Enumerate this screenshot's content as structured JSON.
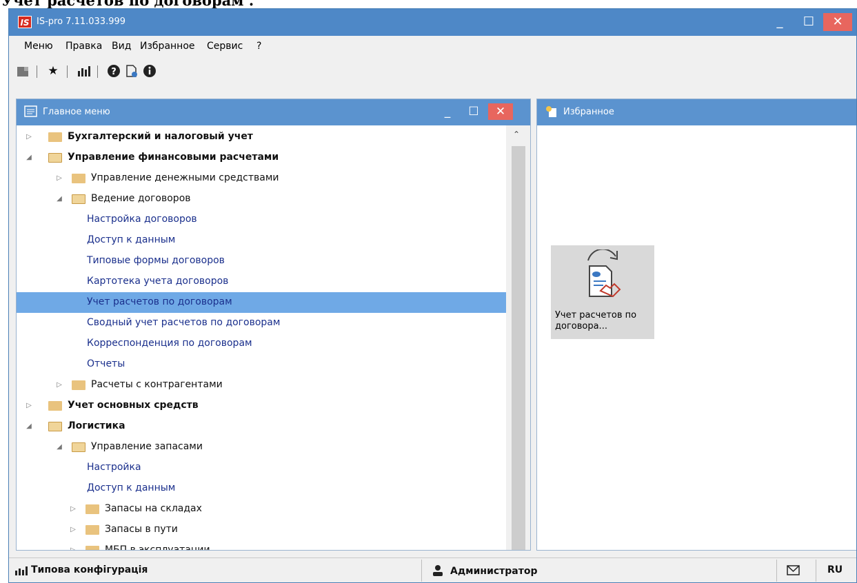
{
  "top_caption": "Учет расчетов по договорам .",
  "window": {
    "title": "IS-pro 7.11.033.999",
    "logo": "IS",
    "controls": {
      "minimize": "_",
      "maximize": "☐",
      "close": "✕"
    }
  },
  "menu": [
    "Меню",
    "Правка",
    "Вид",
    "Избранное",
    "Сервис",
    "?"
  ],
  "toolbar": {
    "icons": [
      "module-icon",
      "star-icon",
      "chart-icon",
      "help-icon",
      "document-info-icon",
      "info-icon"
    ]
  },
  "main_panel": {
    "title": "Главное меню",
    "controls": {
      "minimize": "_",
      "maximize": "☐",
      "close": "✕"
    },
    "tree": [
      {
        "label": "Бухгалтерский и налоговый учет",
        "level": 0,
        "kind": "folder",
        "expanded": false,
        "bold": true
      },
      {
        "label": "Управление финансовыми расчетами",
        "level": 0,
        "kind": "folder",
        "expanded": true,
        "bold": true
      },
      {
        "label": "Управление денежными средствами",
        "level": 1,
        "kind": "folder",
        "expanded": false,
        "bold": false
      },
      {
        "label": "Ведение договоров",
        "level": 1,
        "kind": "folder",
        "expanded": true,
        "bold": false
      },
      {
        "label": "Настройка договоров",
        "level": 2,
        "kind": "item"
      },
      {
        "label": "Доступ к данным",
        "level": 2,
        "kind": "item"
      },
      {
        "label": "Типовые формы договоров",
        "level": 2,
        "kind": "item"
      },
      {
        "label": "Картотека учета договоров",
        "level": 2,
        "kind": "item"
      },
      {
        "label": "Учет расчетов по договорам",
        "level": 2,
        "kind": "item",
        "selected": true
      },
      {
        "label": "Сводный учет расчетов по договорам",
        "level": 2,
        "kind": "item"
      },
      {
        "label": "Корреспонденция по договорам",
        "level": 2,
        "kind": "item"
      },
      {
        "label": "Отчеты",
        "level": 2,
        "kind": "item"
      },
      {
        "label": "Расчеты с контрагентами",
        "level": 1,
        "kind": "folder",
        "expanded": false,
        "bold": false
      },
      {
        "label": "Учет основных средств",
        "level": 0,
        "kind": "folder",
        "expanded": false,
        "bold": true
      },
      {
        "label": "Логистика",
        "level": 0,
        "kind": "folder",
        "expanded": true,
        "bold": true
      },
      {
        "label": "Управление запасами",
        "level": 1,
        "kind": "folder",
        "expanded": true,
        "bold": false
      },
      {
        "label": "Настройка",
        "level": 2,
        "kind": "item"
      },
      {
        "label": "Доступ к данным",
        "level": 2,
        "kind": "item"
      },
      {
        "label": "Запасы на складах",
        "level": 2,
        "kind": "folder",
        "expanded": false,
        "bold": false
      },
      {
        "label": "Запасы в пути",
        "level": 2,
        "kind": "folder",
        "expanded": false,
        "bold": false
      },
      {
        "label": "МБП в эксплуатации",
        "level": 2,
        "kind": "folder",
        "expanded": false,
        "bold": false
      }
    ]
  },
  "favorites_panel": {
    "title": "Избранное",
    "tile_label": "Учет расчетов по договора..."
  },
  "statusbar": {
    "config": "Типова конфігурація",
    "user": "Администратор",
    "mail_icon": "mail-icon",
    "lang": "RU"
  },
  "colors": {
    "titlebar": "#4e88c7",
    "panel_header": "#5b93cf",
    "close_button": "#e8665e",
    "selection": "#6fa9e6",
    "link_text": "#1a2f8c"
  }
}
